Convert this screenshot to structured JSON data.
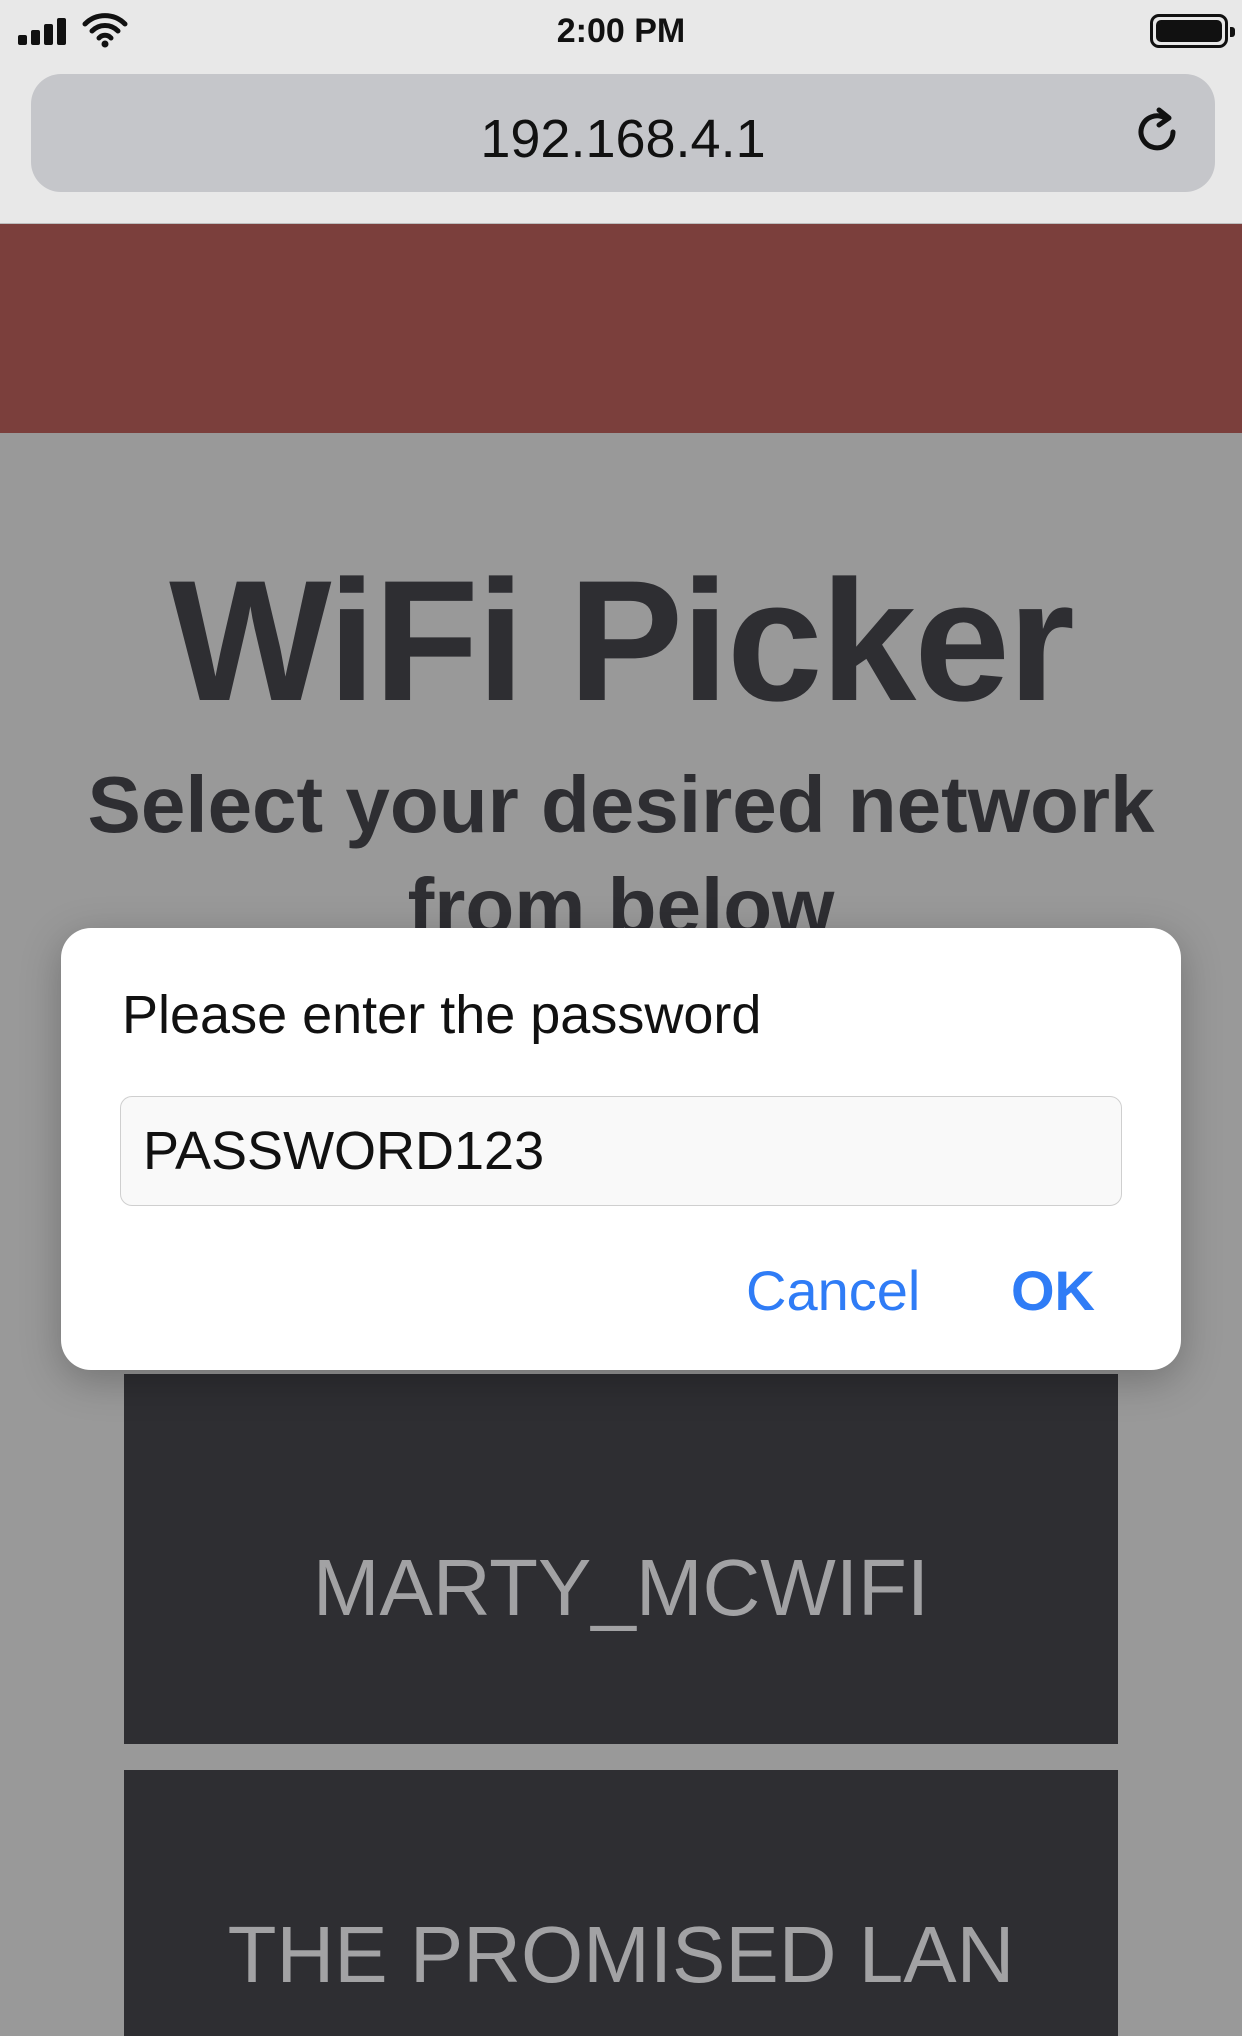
{
  "status_bar": {
    "time": "2:00 PM",
    "signal_icon": "cellular-signal-icon",
    "wifi_icon": "wifi-icon",
    "battery_icon": "battery-full-icon"
  },
  "browser": {
    "url": "192.168.4.1",
    "reload_icon": "reload-icon"
  },
  "page": {
    "banner_color": "#7b3f3c",
    "title": "WiFi Picker",
    "subtitle": "Select your desired network from below",
    "networks": [
      "MARTY_MCWIFI",
      "THE PROMISED LAN"
    ]
  },
  "dialog": {
    "prompt": "Please enter the password",
    "input_value": "PASSWORD123",
    "cancel_label": "Cancel",
    "ok_label": "OK",
    "accent_color": "#2f7cf6"
  }
}
